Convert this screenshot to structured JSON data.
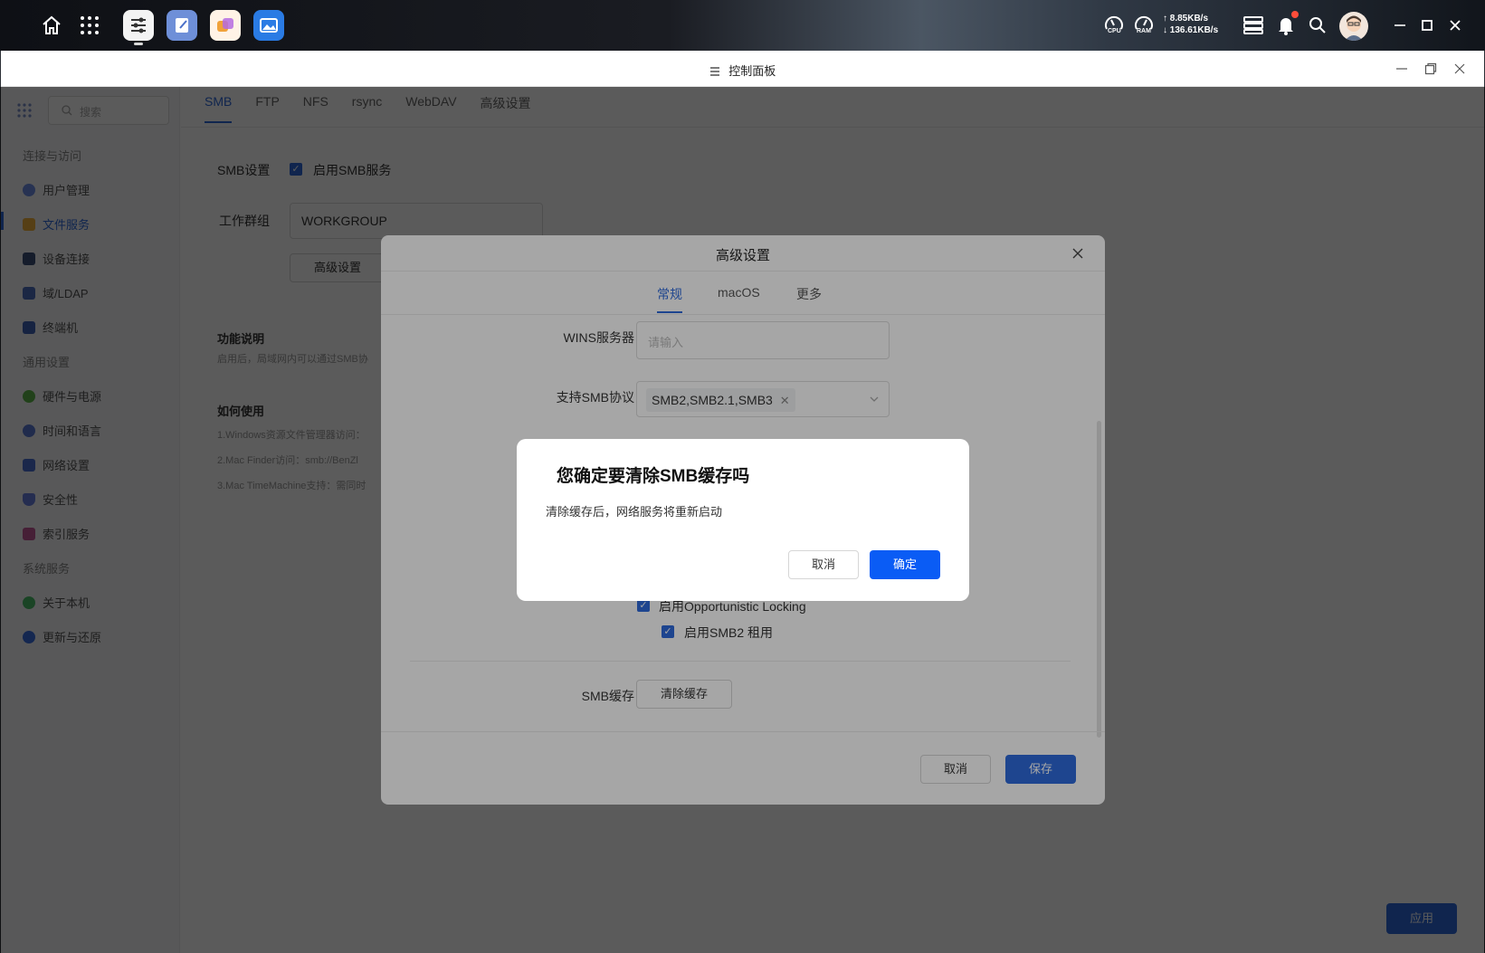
{
  "topbar": {
    "cpu_label": "CPU",
    "ram_label": "RAM",
    "upload_speed": "↑ 8.85KB/s",
    "download_speed": "↓ 136.61KB/s"
  },
  "window": {
    "title": "控制面板"
  },
  "sidebar": {
    "search_placeholder": "搜索",
    "sections": [
      {
        "label": "连接与访问"
      },
      {
        "label": "通用设置"
      },
      {
        "label": "系统服务"
      }
    ],
    "items": [
      {
        "label": "用户管理",
        "color": "#6f8fe6"
      },
      {
        "label": "文件服务",
        "color": "#f0b23c"
      },
      {
        "label": "设备连接",
        "color": "#3d4f7a"
      },
      {
        "label": "域/LDAP",
        "color": "#4e6fbf"
      },
      {
        "label": "终端机",
        "color": "#3f63b8"
      },
      {
        "label": "硬件与电源",
        "color": "#5fb84a"
      },
      {
        "label": "时间和语言",
        "color": "#5b79d6"
      },
      {
        "label": "网络设置",
        "color": "#4a6fd1"
      },
      {
        "label": "安全性",
        "color": "#6b7fe0"
      },
      {
        "label": "索引服务",
        "color": "#c55a9a"
      },
      {
        "label": "关于本机",
        "color": "#4cc06a"
      },
      {
        "label": "更新与还原",
        "color": "#3a6ee0"
      }
    ]
  },
  "main": {
    "tabs": [
      "SMB",
      "FTP",
      "NFS",
      "rsync",
      "WebDAV",
      "高级设置"
    ],
    "smb_settings_label": "SMB设置",
    "enable_smb_label": "启用SMB服务",
    "workgroup_label": "工作群组",
    "workgroup_value": "WORKGROUP",
    "advanced_button": "高级设置",
    "feature_title": "功能说明",
    "feature_desc": "启用后，局域网内可以通过SMB协",
    "howto_title": "如何使用",
    "howto_lines": [
      "1.Windows资源文件管理器访问：",
      "2.Mac Finder访问：smb://BenZl",
      "3.Mac TimeMachine支持：需同时"
    ],
    "apply_button": "应用"
  },
  "modal": {
    "title": "高级设置",
    "tabs": [
      "常规",
      "macOS",
      "更多"
    ],
    "wins_label": "WINS服务器",
    "wins_placeholder": "请输入",
    "protocol_label": "支持SMB协议",
    "protocol_value": "SMB2,SMB2.1,SMB3",
    "oplock_label": "启用Opportunistic Locking",
    "smb2_lease_label": "启用SMB2 租用",
    "cache_label": "SMB缓存",
    "clear_cache_button": "清除缓存",
    "cancel_button": "取消",
    "save_button": "保存"
  },
  "confirm": {
    "title": "您确定要清除SMB缓存吗",
    "message": "清除缓存后，网络服务将重新启动",
    "cancel_button": "取消",
    "ok_button": "确定"
  }
}
